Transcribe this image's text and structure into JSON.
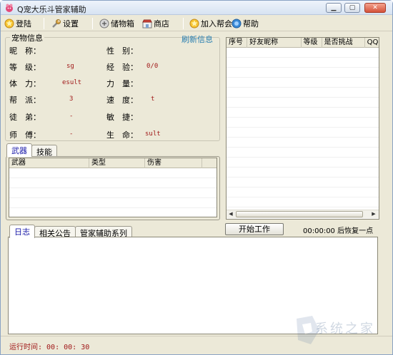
{
  "window": {
    "title": "Q宠大乐斗管家辅助"
  },
  "toolbar": {
    "items": [
      {
        "label": "登陆",
        "icon": "star-icon"
      },
      {
        "label": "设置",
        "icon": "wrench-icon"
      },
      {
        "label": "储物箱",
        "icon": "chest-icon"
      },
      {
        "label": "商店",
        "icon": "shop-icon"
      },
      {
        "label": "加入帮会",
        "icon": "star-icon"
      },
      {
        "label": "帮助",
        "icon": "help-icon"
      }
    ]
  },
  "pet_info": {
    "title": "宠物信息",
    "refresh": "刷新信息",
    "fields": [
      {
        "label": "昵　称：",
        "value": ""
      },
      {
        "label": "性　别：",
        "value": ""
      },
      {
        "label": "等　级：",
        "value": "sg"
      },
      {
        "label": "经　验：",
        "value": "0/0"
      },
      {
        "label": "体　力：",
        "value": "esult"
      },
      {
        "label": "力　量：",
        "value": ""
      },
      {
        "label": "帮　派：",
        "value": "3"
      },
      {
        "label": "速　度：",
        "value": "t"
      },
      {
        "label": "徒　弟：",
        "value": "-"
      },
      {
        "label": "敏　捷：",
        "value": ""
      },
      {
        "label": "师　傅：",
        "value": "-"
      },
      {
        "label": "生　命：",
        "value": "sult"
      }
    ]
  },
  "weapon_tabs": [
    "武器",
    "技能"
  ],
  "weapon_table": {
    "columns": [
      "武器",
      "类型",
      "伤害"
    ]
  },
  "friend_table": {
    "columns": [
      "序号",
      "好友昵称",
      "等级",
      "是否挑战",
      "QQ"
    ]
  },
  "log_tabs": [
    "日志",
    "相关公告",
    "管家辅助系列"
  ],
  "controls": {
    "start_button": "开始工作",
    "recover_text": "00:00:00 后恢复一点"
  },
  "status": {
    "runtime": "运行时间: 00: 00: 30"
  },
  "watermark": "系统之家",
  "colors": {
    "value_red": "#a01818",
    "link_blue": "#2a7fb0",
    "tab_active": "#1a1aa8"
  }
}
